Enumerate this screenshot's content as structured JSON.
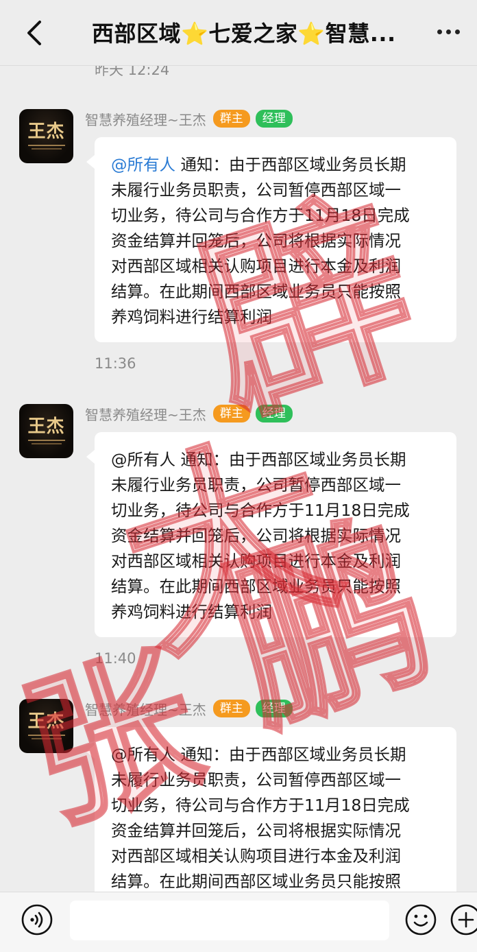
{
  "header": {
    "title": "西部区域⭐七爱之家⭐智慧...",
    "back_icon": "chevron-left-icon",
    "more_icon": "more-dots-icon"
  },
  "messages_top_timestamp": "昨天 12:24",
  "messages": [
    {
      "sender": "智慧养殖经理~王杰",
      "badges": [
        "群主",
        "经理"
      ],
      "avatar_text": "王杰",
      "mention": "@所有人",
      "lines": [
        " 通知：由于西部区域业务员长期",
        "未履行业务员职责，公司暂停西部区域一",
        "切业务，待公司与合作方于11月18日完成",
        "资金结算并回笼后，公司将根据实际情况",
        "对西部区域相关认购项目进行本金及利润",
        "结算。在此期间西部区域业务员只能按照",
        "养鸡饲料进行结算利润"
      ],
      "timestamp_after": "11:36"
    },
    {
      "sender": "智慧养殖经理~王杰",
      "badges": [
        "群主",
        "经理"
      ],
      "avatar_text": "王杰",
      "mention": "@所有人",
      "lines": [
        " 通知：由于西部区域业务员长期",
        "未履行业务员职责，公司暂停西部区域一",
        "切业务，待公司与合作方于11月18日完成",
        "资金结算并回笼后，公司将根据实际情况",
        "对西部区域相关认购项目进行本金及利润",
        "结算。在此期间西部区域业务员只能按照",
        "养鸡饲料进行结算利润"
      ],
      "timestamp_after": "11:40"
    },
    {
      "sender": "智慧养殖经理~王杰",
      "badges": [
        "群主",
        "经理"
      ],
      "avatar_text": "王杰",
      "mention": "@所有人",
      "lines": [
        " 通知：由于西部区域业务员长期",
        "未履行业务员职责，公司暂停西部区域一",
        "切业务，待公司与合作方于11月18日完成",
        "资金结算并回笼后，公司将根据实际情况",
        "对西部区域相关认购项目进行本金及利润",
        "结算。在此期间西部区域业务员只能按照"
      ]
    }
  ],
  "bottom_bar": {
    "voice_icon": "voice-icon",
    "emoji_icon": "emoji-icon",
    "plus_icon": "plus-icon"
  },
  "watermark": {
    "text": "辟谣 大鹏 张桥",
    "color": "#e0303a"
  },
  "colors": {
    "badge_owner": "#f59a1f",
    "badge_manager": "#2fbf5a",
    "mention": "#2a7bd4",
    "background": "#ededed"
  }
}
